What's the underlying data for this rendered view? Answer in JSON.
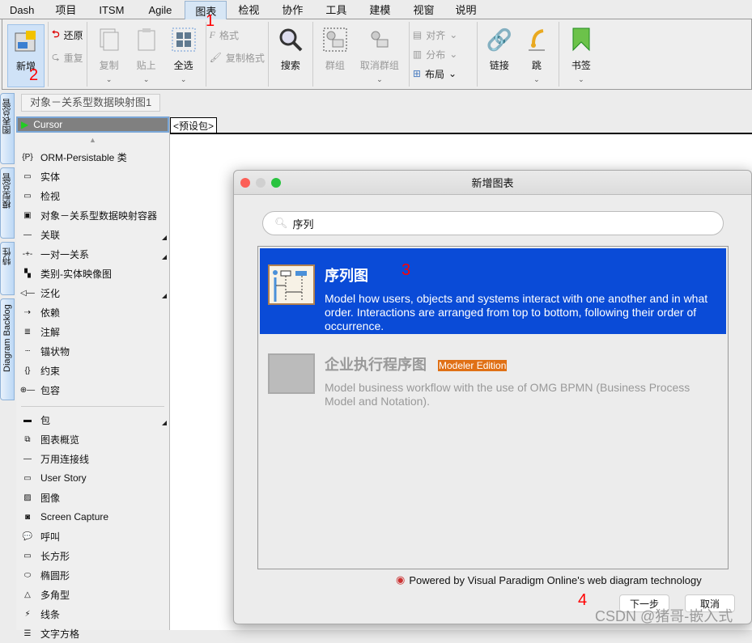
{
  "menubar": {
    "items": [
      "Dash",
      "项目",
      "ITSM",
      "Agile",
      "图表",
      "检视",
      "协作",
      "工具",
      "建模",
      "视窗",
      "说明"
    ],
    "active": "图表"
  },
  "ribbon": {
    "new": "新增",
    "undo": "还原",
    "redo": "重复",
    "copy": "复制",
    "paste": "贴上",
    "select_all": "全选",
    "format": "格式",
    "copy_format": "复制格式",
    "search": "搜索",
    "group": "群组",
    "ungroup": "取消群组",
    "align": "对齐",
    "distribute": "分布",
    "layout": "布局",
    "link": "链接",
    "jump": "跳",
    "bookmark": "书签"
  },
  "annotations": [
    "1",
    "2",
    "3",
    "4"
  ],
  "side_tabs": [
    "图表总管",
    "模型总管",
    "特性",
    "Diagram Backlog"
  ],
  "breadcrumb": "对象－关系型数据映射图1",
  "package_tab": "<预设包>",
  "palette": {
    "cursor": "Cursor",
    "items": [
      {
        "label": "ORM-Persistable 类",
        "icon": "orm-class-icon",
        "sub": false
      },
      {
        "label": "实体",
        "icon": "entity-icon",
        "sub": false
      },
      {
        "label": "检视",
        "icon": "view-icon",
        "sub": false
      },
      {
        "label": "对象－关系型数据映射容器",
        "icon": "orm-container-icon",
        "sub": false
      },
      {
        "label": "关联",
        "icon": "association-icon",
        "sub": true
      },
      {
        "label": "一对一关系",
        "icon": "one-to-one-icon",
        "sub": true
      },
      {
        "label": "类别-实体映像图",
        "icon": "class-entity-mapping-icon",
        "sub": false
      },
      {
        "label": "泛化",
        "icon": "generalization-icon",
        "sub": true
      },
      {
        "label": "依赖",
        "icon": "dependency-icon",
        "sub": false
      },
      {
        "label": "注解",
        "icon": "note-icon",
        "sub": false
      },
      {
        "label": "锚状物",
        "icon": "anchor-icon",
        "sub": false
      },
      {
        "label": "约束",
        "icon": "constraint-icon",
        "sub": false
      },
      {
        "label": "包容",
        "icon": "containment-icon",
        "sub": false
      }
    ],
    "items2": [
      {
        "label": "包",
        "icon": "package-icon",
        "sub": true
      },
      {
        "label": "图表概览",
        "icon": "diagram-overview-icon",
        "sub": false
      },
      {
        "label": "万用连接线",
        "icon": "connector-icon",
        "sub": false
      },
      {
        "label": "User Story",
        "icon": "user-story-icon",
        "sub": false
      },
      {
        "label": "图像",
        "icon": "image-icon",
        "sub": false
      },
      {
        "label": "Screen Capture",
        "icon": "camera-icon",
        "sub": false
      },
      {
        "label": "呼叫",
        "icon": "callout-icon",
        "sub": false
      },
      {
        "label": "长方形",
        "icon": "rectangle-icon",
        "sub": false
      },
      {
        "label": "椭圆形",
        "icon": "ellipse-icon",
        "sub": false
      },
      {
        "label": "多角型",
        "icon": "polygon-icon",
        "sub": false
      },
      {
        "label": "线条",
        "icon": "line-icon",
        "sub": false
      },
      {
        "label": "文字方格",
        "icon": "textbox-icon",
        "sub": false
      }
    ]
  },
  "dialog": {
    "title": "新增图表",
    "search_value": "序列",
    "results": [
      {
        "title": "序列图",
        "description": "Model how users, objects and systems interact with one another and in what order. Interactions are arranged from top to bottom, following their order of occurrence.",
        "selected": true
      },
      {
        "title": "企业执行程序图",
        "badge": "Modeler Edition",
        "description": "Model business workflow with the use of OMG BPMN (Business Process Model and Notation).",
        "selected": false
      }
    ],
    "powered": "Powered by Visual Paradigm Online's web diagram technology",
    "next": "下一步",
    "cancel": "取消"
  },
  "watermark": "CSDN @猪哥-嵌入式",
  "colors": {
    "selection": "#0a4bd7",
    "badge": "#e07015",
    "annotation": "#ff0000"
  }
}
